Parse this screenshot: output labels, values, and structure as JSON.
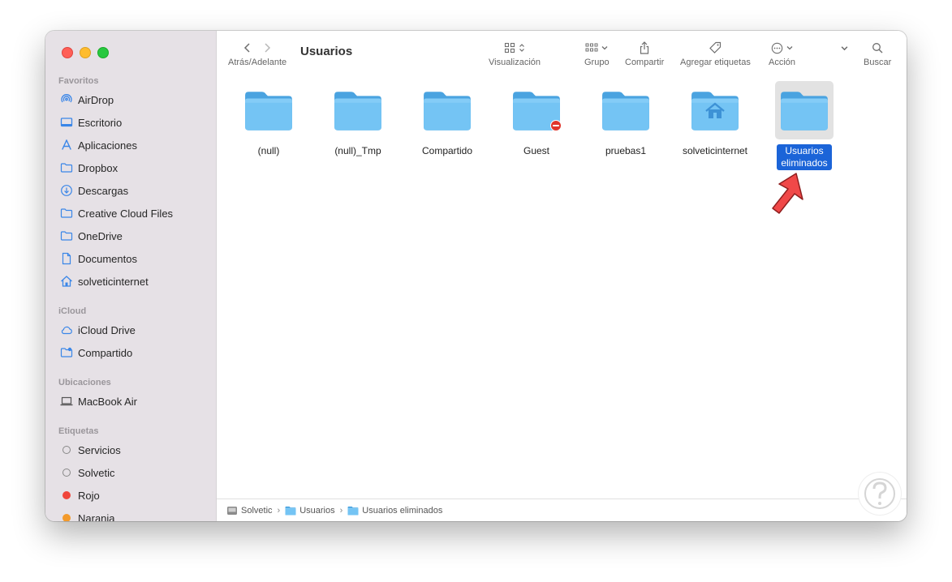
{
  "window": {
    "title": "Usuarios"
  },
  "sidebar": {
    "sections": [
      {
        "label": "Favoritos",
        "items": [
          {
            "label": "AirDrop",
            "icon": "airdrop-icon"
          },
          {
            "label": "Escritorio",
            "icon": "desktop-icon"
          },
          {
            "label": "Aplicaciones",
            "icon": "applications-icon"
          },
          {
            "label": "Dropbox",
            "icon": "folder-icon"
          },
          {
            "label": "Descargas",
            "icon": "downloads-icon"
          },
          {
            "label": "Creative Cloud Files",
            "icon": "folder-icon"
          },
          {
            "label": "OneDrive",
            "icon": "folder-icon"
          },
          {
            "label": "Documentos",
            "icon": "document-icon"
          },
          {
            "label": "solveticinternet",
            "icon": "home-icon"
          }
        ]
      },
      {
        "label": "iCloud",
        "items": [
          {
            "label": "iCloud Drive",
            "icon": "cloud-icon"
          },
          {
            "label": "Compartido",
            "icon": "shared-folder-icon"
          }
        ]
      },
      {
        "label": "Ubicaciones",
        "items": [
          {
            "label": "MacBook Air",
            "icon": "laptop-icon"
          }
        ]
      },
      {
        "label": "Etiquetas",
        "items": [
          {
            "label": "Servicios",
            "icon": "tag-empty-icon"
          },
          {
            "label": "Solvetic",
            "icon": "tag-empty-icon"
          },
          {
            "label": "Rojo",
            "icon": "tag-red-icon",
            "color": "#f0453a"
          },
          {
            "label": "Naranja",
            "icon": "tag-orange-icon",
            "color": "#f39a2b"
          }
        ]
      }
    ]
  },
  "toolbar": {
    "nav_label": "Atrás/Adelante",
    "view_label": "Visualización",
    "group_label": "Grupo",
    "share_label": "Compartir",
    "tags_label": "Agregar etiquetas",
    "action_label": "Acción",
    "search_label": "Buscar"
  },
  "items": [
    {
      "name": "(null)",
      "badge": null,
      "selected": false
    },
    {
      "name": "(null)_Tmp",
      "badge": null,
      "selected": false
    },
    {
      "name": "Compartido",
      "badge": null,
      "selected": false
    },
    {
      "name": "Guest",
      "badge": "no-access",
      "selected": false
    },
    {
      "name": "pruebas1",
      "badge": null,
      "selected": false
    },
    {
      "name": "solveticinternet",
      "badge": "home",
      "selected": false
    },
    {
      "name": "Usuarios eliminados",
      "badge": null,
      "selected": true
    }
  ],
  "pathbar": [
    "Solvetic",
    "Usuarios",
    "Usuarios eliminados"
  ],
  "colors": {
    "folder": "#69bdf0",
    "selection": "#1b64d8",
    "arrow": "#f04848"
  }
}
